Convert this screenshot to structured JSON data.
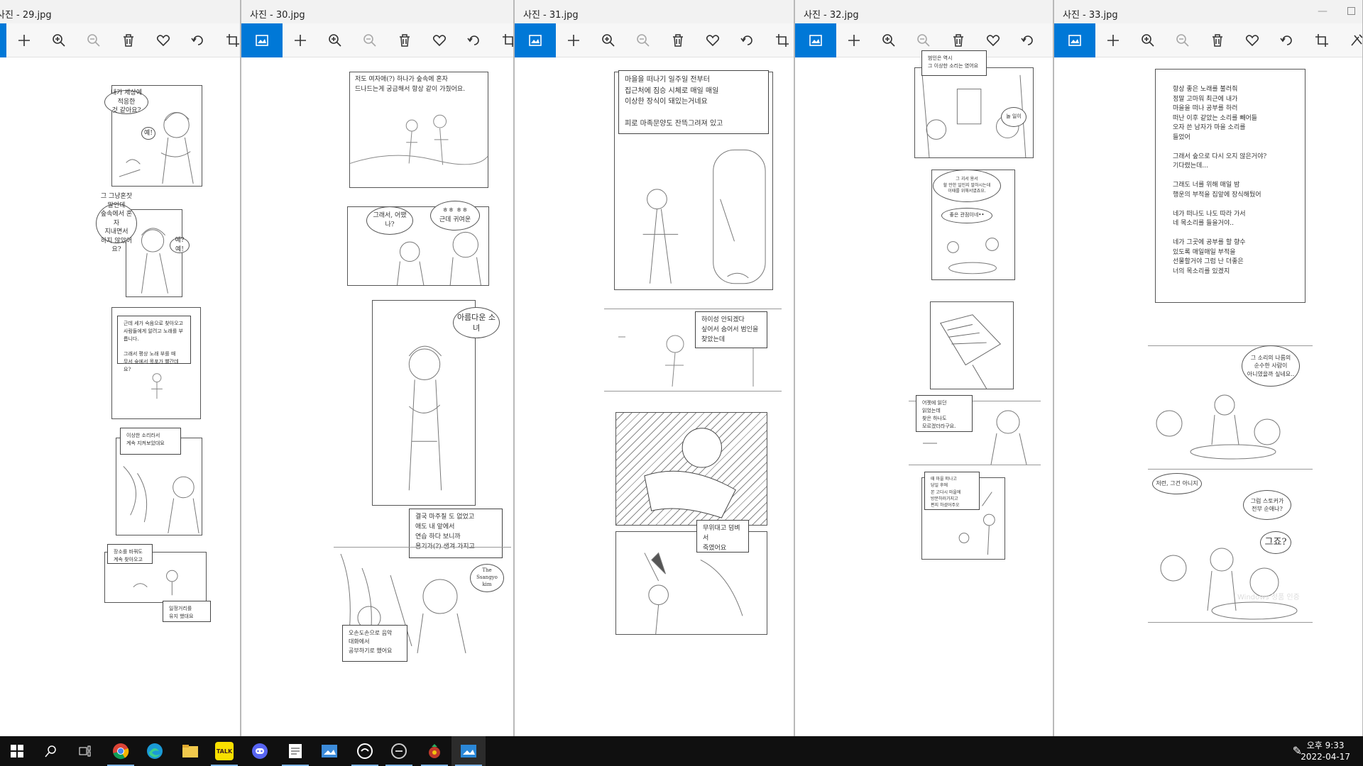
{
  "windows": [
    {
      "title": "사진 - 29.jpg"
    },
    {
      "title": "사진 - 30.jpg"
    },
    {
      "title": "사진 - 31.jpg"
    },
    {
      "title": "사진 - 32.jpg"
    },
    {
      "title": "사진 - 33.jpg"
    }
  ],
  "toolbar_icons": [
    "image-icon",
    "add-icon",
    "zoom-in-icon",
    "zoom-out-icon",
    "delete-icon",
    "favorite-icon",
    "rotate-icon",
    "crop-icon",
    "edit-icon"
  ],
  "accent_color": "#0078d7",
  "page29": {
    "bub1": "내가 세상에 적응한\n것 같아요?",
    "bub2": "예!",
    "bub3": "그 그냥혼잣말인데\n숲속에서 혼자\n지내면서\n하지 않았어요?",
    "bub4": "예? 예!",
    "cap1": "근데 세가 숙음으로 찾아오고\n사람들에게 알려고 노래를 부릅니다.\n\n그래서 평상 노래 부를 때\n무서 숲에서 목포가 빨간데요?",
    "cap2": "이상한 소리라서\n계속 지켜보았대요",
    "cap3": "장소를 바꿔도\n계속 찾아오고",
    "cap4": "일정거리를\n유지 했대요"
  },
  "page30": {
    "cap1": "저도 여자애(?) 하나가 숲속에 혼자\n드나드는게 궁금해서 항상 같이 가줬어요.",
    "bub1": "그래서, 어땠나?",
    "bub2": "ㅎㅎ ㅎㅎ\n근데 귀여운",
    "bub3": "아름다운 소녀",
    "cap2": "결국 마주칠 도 없었고\n애도 내 앞에서\n연습 하다 보니까\n용기가(?) 생겨 가지고",
    "bub4": "The Ssangyo kim",
    "cap3": "오손도손으로 음악\n대화에서\n공부하기로 했어요"
  },
  "page31": {
    "cap1": "마을을 떠나기 일주일 전부터\n집근처에 짐승 시체로 매일 매일\n이상한 장식이 돼있는거네요\n\n피로 마족문양도 잔뜩그려져 있고",
    "cap2": "하이성 안되겠다\n싶어서 숨어서 범인을\n찾았는데",
    "cap3": "무위대고 덤벼서\n죽였어요"
  },
  "page32": {
    "cap1": "범인은 역시\n그 이상한 소리는 였어요",
    "bub1": "놀 일이",
    "bub2": "그 괴서 용서\n할 만한 일인지 말하시는데\n이때를 위해서였죠요.",
    "bub3": "좋은 관점이네••",
    "cap2": "어젯에 읽던\n읽었는데\n찾은 하나도\n모르겠더라구요.",
    "cap3": "때 마을 떠나고\n당일 후에\n본 고다시 마을에\n방문하러가지고\n편지 하셨어주오"
  },
  "page33": {
    "note": "항상 좋은 노래를 불러줘\n정말 고마워      최근에 내가\n마을을 떠나      공부를 하러\n떠난 이후 같았는 소리를 빼어들\n오자 쓴 남자가 마을 소리를\n들었어\n\n그래서 숲으로 다시 오지 않은거야?\n기다렸는데...\n\n그래도 너를 위해 매일 밤\n행운의 부적을 집앞에 장식해뒀어\n\n네가 떠나도 나도 따라 가서\n네 목소리를 들을거야..\n\n네가 그곳에 공부를 할 향수\n있도록 매일매일 부적을\n선물할거야 그럼 난 더좋은\n너의 목소리를 있겠지",
    "bub1": "그 소리의 나름의\n순수한 사람이\n아니였을까 싶네요..",
    "bub2": "저런, 그건 아니지",
    "bub3": "그럼 스토커가\n전부 순애나?",
    "bub4": "그죠?",
    "watermark": "Windows 정품 인증"
  },
  "taskbar": {
    "items": [
      "start-icon",
      "search-icon",
      "task-view-icon",
      "chrome-icon",
      "edge-icon",
      "file-explorer-icon",
      "kakaotalk-icon",
      "discord-icon",
      "notepad-icon",
      "photos-viewer-icon",
      "app-icon-1",
      "app-icon-2",
      "game-icon",
      "photos-icon"
    ],
    "kakao_label": "TALK",
    "time": "오후 9:33",
    "date": "2022-04-17"
  }
}
